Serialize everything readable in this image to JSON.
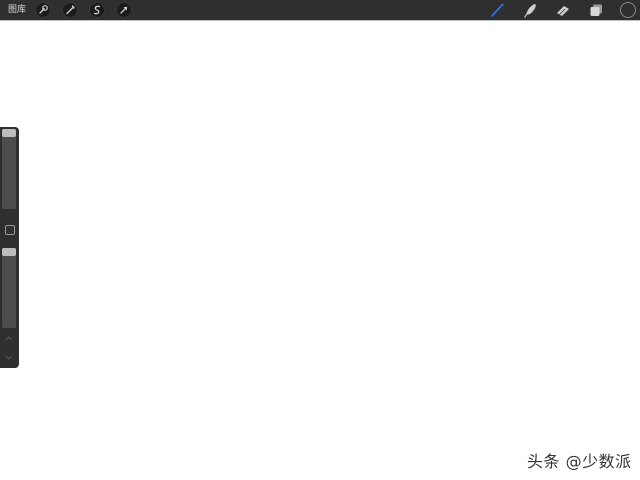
{
  "toolbar": {
    "gallery_label": "图库",
    "left_tools": [
      "wrench-icon",
      "magic-wand-icon",
      "selection-icon",
      "transform-icon"
    ],
    "right_tools": [
      "brush-icon",
      "smudge-icon",
      "eraser-icon",
      "layers-icon",
      "color-icon"
    ],
    "colors": {
      "bar": "#2f2f2f",
      "active_tool": "#2e6fe0",
      "icon": "#d0d0d0"
    }
  },
  "sidebar": {
    "brush_size_level": 1.0,
    "opacity_level": 1.0,
    "buttons": [
      "modify-button",
      "undo-arrow-icon",
      "redo-arrow-icon"
    ]
  },
  "watermark": {
    "text": "头条 @少数派"
  }
}
